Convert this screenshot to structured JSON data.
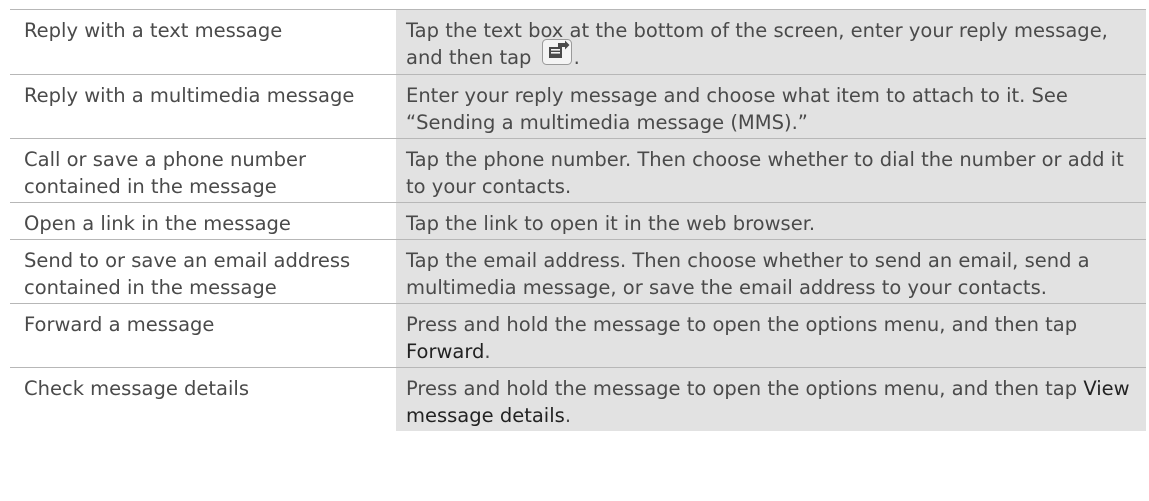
{
  "rows": [
    {
      "action": "Reply with a text message",
      "desc_before": "Tap the text box at the bottom of the screen, enter your reply message, and then tap",
      "icon": "send-reply-icon",
      "desc_after": "."
    },
    {
      "action": "Reply with a multimedia message",
      "desc": "Enter your reply message and choose what item to attach to it. See “Sending a multimedia message (MMS).”"
    },
    {
      "action": "Call or save a phone number contained in the message",
      "desc": "Tap the phone number. Then choose whether to dial the number or add it to your contacts."
    },
    {
      "action": "Open a link in the message",
      "desc": "Tap the link to open it in the web browser."
    },
    {
      "action": "Send to or save an email address contained in the message",
      "desc": "Tap the email address. Then choose whether to send an email, send a multimedia message, or save the email address to your contacts."
    },
    {
      "action": "Forward a message",
      "desc_before": "Press and hold the message to open the options menu, and then tap",
      "desc_strong": "Forward",
      "desc_after": "."
    },
    {
      "action": "Check message details",
      "desc_before": "Press and hold the message to open the options menu, and then tap",
      "desc_strong": "View message details",
      "desc_after": "."
    }
  ]
}
